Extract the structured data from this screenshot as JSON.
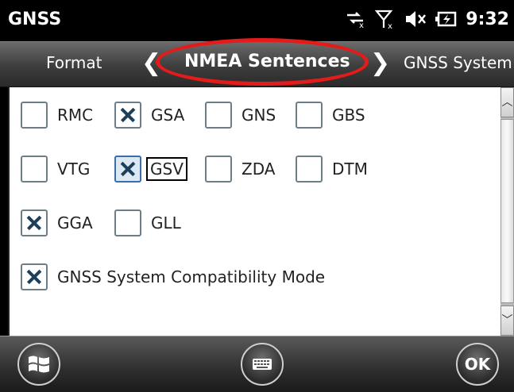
{
  "status_bar": {
    "app_title": "GNSS",
    "time": "9:32",
    "icons": [
      "data-connection-icon",
      "signal-no-service-icon",
      "speaker-muted-icon",
      "battery-charging-icon"
    ]
  },
  "tabs": {
    "previous": "Format",
    "active": "NMEA Sentences",
    "next": "GNSS System"
  },
  "checkboxes": [
    {
      "label": "RMC",
      "checked": false
    },
    {
      "label": "GSA",
      "checked": true
    },
    {
      "label": "GNS",
      "checked": false
    },
    {
      "label": "GBS",
      "checked": false
    },
    {
      "label": "VTG",
      "checked": false
    },
    {
      "label": "GSV",
      "checked": true,
      "focused": true
    },
    {
      "label": "ZDA",
      "checked": false
    },
    {
      "label": "DTM",
      "checked": false
    },
    {
      "label": "GGA",
      "checked": true
    },
    {
      "label": "GLL",
      "checked": false
    },
    {
      "label": "GNSS System Compatibility Mode",
      "checked": true
    }
  ],
  "bottom_bar": {
    "ok_label": "OK"
  },
  "colors": {
    "highlight_ring": "#e31b1b",
    "check_mark": "#1c3f5a"
  }
}
